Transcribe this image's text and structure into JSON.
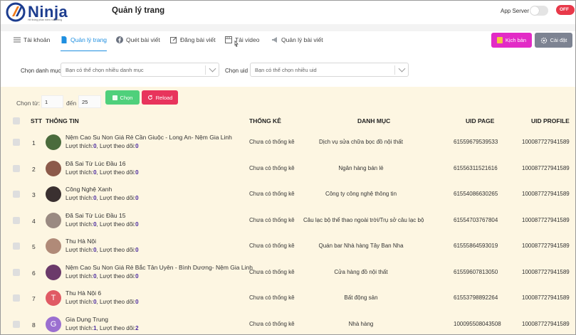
{
  "app": {
    "logo_text": "Ninja",
    "logo_tagline": "Hệ thống phần mềm marketing",
    "page_title": "Quản lý trang"
  },
  "header": {
    "app_server_label": "App Server",
    "off_label": "OFF"
  },
  "tabs": [
    {
      "label": "Tài khoản",
      "icon": "list-icon"
    },
    {
      "label": "Quản lý trang",
      "icon": "document-icon",
      "active": true
    },
    {
      "label": "Quét bài viết",
      "icon": "facebook-icon"
    },
    {
      "label": "Đăng bài viết",
      "icon": "edit-icon"
    },
    {
      "label": "Tải video",
      "icon": "video-icon"
    },
    {
      "label": "Quản lý bài viết",
      "icon": "megaphone-icon"
    }
  ],
  "actions": {
    "script_label": "Kịch bản",
    "settings_label": "Cài đặt"
  },
  "filters": {
    "category_label": "Chọn danh mục :",
    "category_placeholder": "Bạn có thể chọn nhiều danh mục",
    "uid_label": "Chọn uid :",
    "uid_placeholder": "Bạn có thể chọn nhiều uid"
  },
  "range": {
    "from_label": "Chọn từ:",
    "from_value": "1",
    "to_label": "đến",
    "to_value": "25",
    "select_label": "Chọn",
    "reload_label": "Reload"
  },
  "table": {
    "headers": [
      "STT",
      "THÔNG TIN",
      "THỐNG KÊ",
      "DANH MỤC",
      "UID PAGE",
      "UID PROFILE"
    ],
    "like_label": "Lượt thích:",
    "follow_label": "Lượt theo dõi:",
    "rows": [
      {
        "stt": "1",
        "name": "Nệm Cao Su Non Giá Rẻ Cần Giuộc - Long An- Nệm Gia Linh",
        "likes": "0",
        "follows": "0",
        "stat": "Chưa có thống kê",
        "category": "Dịch vụ sửa chữa bọc đồ nội thất",
        "uid_page": "61559679539533",
        "uid_profile": "100087727941589",
        "avatar_color": "#4a6b3c",
        "avatar_letter": ""
      },
      {
        "stt": "2",
        "name": "Đã Sai Từ Lúc Đầu 16",
        "likes": "0",
        "follows": "0",
        "stat": "Chưa có thống kê",
        "category": "Ngân hàng bán lẻ",
        "uid_page": "61556311521616",
        "uid_profile": "100087727941589",
        "avatar_color": "#8c5a4a",
        "avatar_letter": ""
      },
      {
        "stt": "3",
        "name": "Công Nghệ Xanh",
        "likes": "0",
        "follows": "0",
        "stat": "Chưa có thống kê",
        "category": "Công ty công nghệ thông tin",
        "uid_page": "61554086630265",
        "uid_profile": "100087727941589",
        "avatar_color": "#3a3030",
        "avatar_letter": ""
      },
      {
        "stt": "4",
        "name": "Đã Sai Từ Lúc Đầu 15",
        "likes": "0",
        "follows": "0",
        "stat": "Chưa có thống kê",
        "category": "Câu lạc bộ thể thao ngoài trời/Trụ sở câu lạc bộ",
        "uid_page": "61554703767804",
        "uid_profile": "100087727941589",
        "avatar_color": "#9a8a82",
        "avatar_letter": ""
      },
      {
        "stt": "5",
        "name": "Thu Hà Nội",
        "likes": "0",
        "follows": "0",
        "stat": "Chưa có thống kê",
        "category": "Quán bar Nhà hàng Tây Ban Nha",
        "uid_page": "61555864593019",
        "uid_profile": "100087727941589",
        "avatar_color": "#b08a78",
        "avatar_letter": ""
      },
      {
        "stt": "6",
        "name": "Nệm Cao Su Non Giá Rẻ Bắc Tân Uyên - Bình Dương- Nệm Gia Linh",
        "likes": "0",
        "follows": "0",
        "stat": "Chưa có thống kê",
        "category": "Cửa hàng đồ nội thất",
        "uid_page": "61559607813050",
        "uid_profile": "100087727941589",
        "avatar_color": "#6b3a6a",
        "avatar_letter": ""
      },
      {
        "stt": "7",
        "name": "Thu Hà Nội 6",
        "likes": "0",
        "follows": "0",
        "stat": "Chưa có thống kê",
        "category": "Bất động sản",
        "uid_page": "61553798892264",
        "uid_profile": "100087727941589",
        "avatar_color": "#e05a64",
        "avatar_letter": "T"
      },
      {
        "stt": "8",
        "name": "Gia Dụng Trung",
        "likes": "1",
        "follows": "2",
        "stat": "Chưa có thống kê",
        "category": "Nhà hàng",
        "uid_page": "100095508043508",
        "uid_profile": "100087727941589",
        "avatar_color": "#9b6fd0",
        "avatar_letter": "G"
      }
    ]
  },
  "colors": {
    "accent": "#1f8fe0",
    "script_button": "#e22bc6",
    "settings_button": "#7d8392",
    "select_button": "#4fd07b",
    "reload_button": "#e8345c",
    "content_bg": "#fdf6e2",
    "off_toggle": "#e8394a"
  }
}
